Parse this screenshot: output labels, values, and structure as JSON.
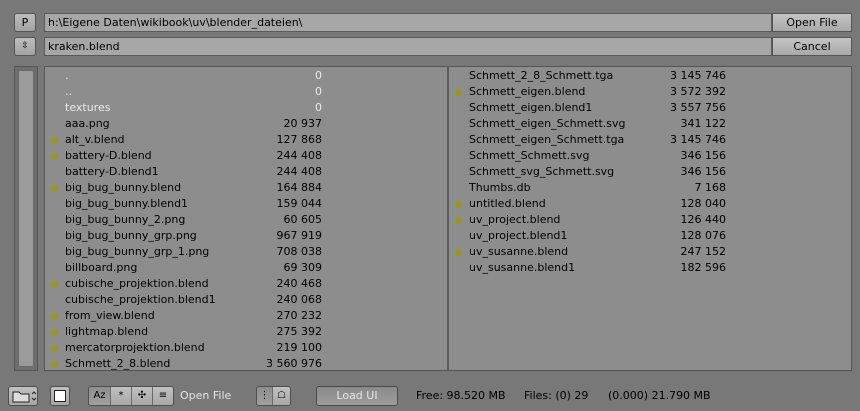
{
  "header": {
    "p_button": "P",
    "sort_button": "⇳",
    "directory": "h:\\Eigene Daten\\wikibook\\uv\\blender_dateien\\",
    "filename": "kraken.blend",
    "open_button": "Open File",
    "cancel_button": "Cancel"
  },
  "files_left": [
    {
      "name": ".",
      "size": "0",
      "dot": false,
      "dim": true
    },
    {
      "name": "..",
      "size": "0",
      "dot": false,
      "dim": true
    },
    {
      "name": "textures",
      "size": "0",
      "dot": false,
      "dim": true
    },
    {
      "name": "aaa.png",
      "size": "20 937",
      "dot": false,
      "dim": false
    },
    {
      "name": "alt_v.blend",
      "size": "127 868",
      "dot": true,
      "dim": false
    },
    {
      "name": "battery-D.blend",
      "size": "244 408",
      "dot": true,
      "dim": false
    },
    {
      "name": "battery-D.blend1",
      "size": "244 408",
      "dot": false,
      "dim": false
    },
    {
      "name": "big_bug_bunny.blend",
      "size": "164 884",
      "dot": true,
      "dim": false
    },
    {
      "name": "big_bug_bunny.blend1",
      "size": "159 044",
      "dot": false,
      "dim": false
    },
    {
      "name": "big_bug_bunny_2.png",
      "size": "60 605",
      "dot": false,
      "dim": false
    },
    {
      "name": "big_bug_bunny_grp.png",
      "size": "967 919",
      "dot": false,
      "dim": false
    },
    {
      "name": "big_bug_bunny_grp_1.png",
      "size": "708 038",
      "dot": false,
      "dim": false
    },
    {
      "name": "billboard.png",
      "size": "69 309",
      "dot": false,
      "dim": false
    },
    {
      "name": "cubische_projektion.blend",
      "size": "240 468",
      "dot": true,
      "dim": false
    },
    {
      "name": "cubische_projektion.blend1",
      "size": "240 068",
      "dot": false,
      "dim": false
    },
    {
      "name": "from_view.blend",
      "size": "270 232",
      "dot": true,
      "dim": false
    },
    {
      "name": "lightmap.blend",
      "size": "275 392",
      "dot": true,
      "dim": false
    },
    {
      "name": "mercatorprojektion.blend",
      "size": "219 100",
      "dot": true,
      "dim": false
    },
    {
      "name": "Schmett_2_8.blend",
      "size": "3 560 976",
      "dot": true,
      "dim": false
    }
  ],
  "files_right": [
    {
      "name": "Schmett_2_8_Schmett.tga",
      "size": "3 145 746",
      "dot": false,
      "dim": false
    },
    {
      "name": "Schmett_eigen.blend",
      "size": "3 572 392",
      "dot": true,
      "dim": false
    },
    {
      "name": "Schmett_eigen.blend1",
      "size": "3 557 756",
      "dot": false,
      "dim": false
    },
    {
      "name": "Schmett_eigen_Schmett.svg",
      "size": "341 122",
      "dot": false,
      "dim": false
    },
    {
      "name": "Schmett_eigen_Schmett.tga",
      "size": "3 145 746",
      "dot": false,
      "dim": false
    },
    {
      "name": "Schmett_Schmett.svg",
      "size": "346 156",
      "dot": false,
      "dim": false
    },
    {
      "name": "Schmett_svg_Schmett.svg",
      "size": "346 156",
      "dot": false,
      "dim": false
    },
    {
      "name": "Thumbs.db",
      "size": "7 168",
      "dot": false,
      "dim": false
    },
    {
      "name": "untitled.blend",
      "size": "128 040",
      "dot": true,
      "dim": false
    },
    {
      "name": "uv_project.blend",
      "size": "126 440",
      "dot": true,
      "dim": false
    },
    {
      "name": "uv_project.blend1",
      "size": "128 076",
      "dot": false,
      "dim": false
    },
    {
      "name": "uv_susanne.blend",
      "size": "247 152",
      "dot": true,
      "dim": false
    },
    {
      "name": "uv_susanne.blend1",
      "size": "182 596",
      "dot": false,
      "dim": false
    }
  ],
  "toolbar": {
    "mode_label": "Open File",
    "load_ui": "Load UI",
    "free": "Free: 98.520 MB",
    "files": "Files: (0) 29",
    "selected": "(0.000) 21.790 MB",
    "sort_alpha": "Az",
    "sort_time": "*",
    "sort_size": "✣",
    "sort_ext": "≡"
  },
  "colors": {
    "background": "#787878",
    "list_bg": "#8d8d8d",
    "blend_dot": "#9a9622"
  }
}
